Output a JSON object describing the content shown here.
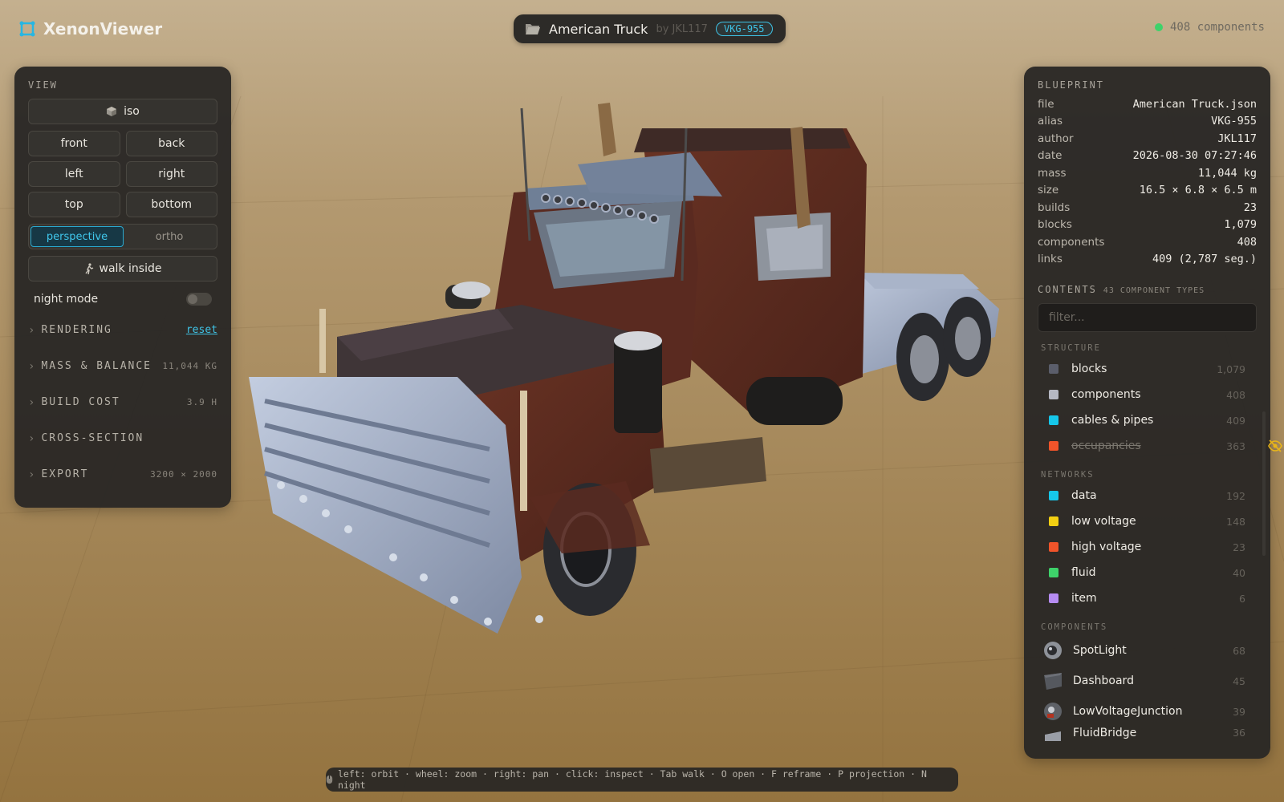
{
  "app": {
    "name": "XenonViewer"
  },
  "header": {
    "title": "American Truck",
    "by": "by JKL117",
    "badge": "VKG-955",
    "components": "408 components"
  },
  "view": {
    "label": "VIEW",
    "iso": "iso",
    "front": "front",
    "back": "back",
    "left": "left",
    "right": "right",
    "top": "top",
    "bottom": "bottom",
    "perspective": "perspective",
    "ortho": "ortho",
    "projection_selected": "perspective",
    "walk": "walk inside",
    "night": "night mode",
    "night_on": false
  },
  "sections": [
    {
      "label": "RENDERING",
      "meta": "reset",
      "is_link": true
    },
    {
      "label": "MASS & BALANCE",
      "meta": "11,044 KG"
    },
    {
      "label": "BUILD COST",
      "meta": "3.9 H"
    },
    {
      "label": "CROSS-SECTION",
      "meta": ""
    },
    {
      "label": "EXPORT",
      "meta": "3200 × 2000"
    }
  ],
  "blueprint": {
    "label": "BLUEPRINT",
    "rows": [
      {
        "k": "file",
        "v": "American Truck.json"
      },
      {
        "k": "alias",
        "v": "VKG-955"
      },
      {
        "k": "author",
        "v": "JKL117"
      },
      {
        "k": "date",
        "v": "2026-08-30 07:27:46"
      },
      {
        "k": "mass",
        "v": "11,044 kg"
      },
      {
        "k": "size",
        "v": "16.5 × 6.8 × 6.5 m"
      },
      {
        "k": "builds",
        "v": "23"
      },
      {
        "k": "blocks",
        "v": "1,079"
      },
      {
        "k": "components",
        "v": "408"
      },
      {
        "k": "links",
        "v": "409 (2,787 seg.)"
      }
    ]
  },
  "contents": {
    "label": "CONTENTS",
    "sub": "43 COMPONENT TYPES",
    "filter_placeholder": "filter...",
    "structure_label": "STRUCTURE",
    "structure": [
      {
        "name": "blocks",
        "count": "1,079",
        "color": "#5b5e6b"
      },
      {
        "name": "components",
        "count": "408",
        "color": "#b5b8c2"
      },
      {
        "name": "cables & pipes",
        "count": "409",
        "color": "#16c7ea"
      },
      {
        "name": "occupancies",
        "count": "363",
        "color": "#f0542a",
        "hidden": true
      }
    ],
    "networks_label": "NETWORKS",
    "networks": [
      {
        "name": "data",
        "count": "192",
        "color": "#16c7ea"
      },
      {
        "name": "low voltage",
        "count": "148",
        "color": "#f2cf12"
      },
      {
        "name": "high voltage",
        "count": "23",
        "color": "#f0542a"
      },
      {
        "name": "fluid",
        "count": "40",
        "color": "#3ed26a"
      },
      {
        "name": "item",
        "count": "6",
        "color": "#b68cf2"
      }
    ],
    "components_label": "COMPONENTS",
    "components": [
      {
        "name": "SpotLight",
        "count": "68",
        "icon": "spotlight-icon"
      },
      {
        "name": "Dashboard",
        "count": "45",
        "icon": "dashboard-icon"
      },
      {
        "name": "LowVoltageJunction",
        "count": "39",
        "icon": "junction-icon"
      },
      {
        "name": "FluidBridge",
        "count": "36",
        "icon": "fluid-bridge-icon"
      }
    ]
  },
  "hint": "left: orbit · wheel: zoom · right: pan · click: inspect · Tab walk · O open · F reframe · P projection · N night"
}
